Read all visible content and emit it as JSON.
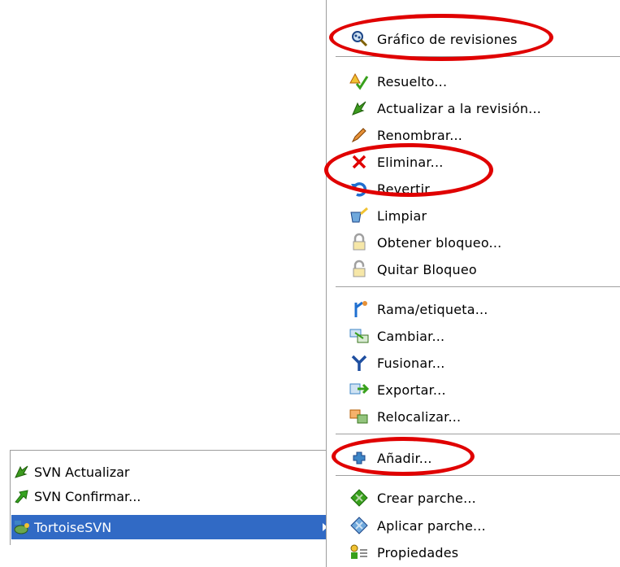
{
  "left_menu": {
    "items": [
      {
        "label": "SVN Actualizar",
        "icon": "svn-update-icon"
      },
      {
        "label": "SVN Confirmar...",
        "icon": "svn-commit-icon"
      },
      {
        "label": "TortoiseSVN",
        "icon": "tortoisesvn-icon",
        "selected": true,
        "has_submenu": true
      }
    ]
  },
  "right_menu": {
    "items": [
      {
        "label": "Gráfico de revisiones",
        "icon": "revision-graph-icon"
      },
      {
        "label": "Resuelto...",
        "icon": "resolved-icon"
      },
      {
        "label": "Actualizar a la revisión...",
        "icon": "update-to-revision-icon"
      },
      {
        "label": "Renombrar...",
        "icon": "rename-icon"
      },
      {
        "label": "Eliminar...",
        "icon": "delete-icon"
      },
      {
        "label": "Revertir...",
        "icon": "revert-icon"
      },
      {
        "label": "Limpiar",
        "icon": "cleanup-icon"
      },
      {
        "label": "Obtener bloqueo...",
        "icon": "lock-icon"
      },
      {
        "label": "Quitar Bloqueo",
        "icon": "unlock-icon"
      },
      {
        "label": "Rama/etiqueta...",
        "icon": "branch-tag-icon"
      },
      {
        "label": "Cambiar...",
        "icon": "switch-icon"
      },
      {
        "label": "Fusionar...",
        "icon": "merge-icon"
      },
      {
        "label": "Exportar...",
        "icon": "export-icon"
      },
      {
        "label": "Relocalizar...",
        "icon": "relocate-icon"
      },
      {
        "label": "Añadir...",
        "icon": "add-icon"
      },
      {
        "label": "Crear parche...",
        "icon": "create-patch-icon"
      },
      {
        "label": "Aplicar parche...",
        "icon": "apply-patch-icon"
      },
      {
        "label": "Propiedades",
        "icon": "properties-icon"
      }
    ]
  },
  "colors": {
    "selection": "#316ac5",
    "highlight_oval": "#e00000",
    "separator": "#a0a0a0"
  }
}
